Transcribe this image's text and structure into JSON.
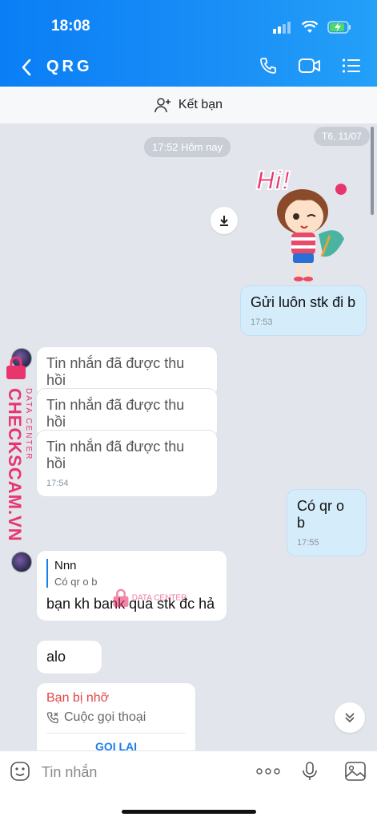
{
  "status_bar": {
    "time": "18:08"
  },
  "header": {
    "title": "QRG"
  },
  "friend_bar": {
    "label": "Kết bạn"
  },
  "chat": {
    "date_pill": "T6, 11/07",
    "time_pill": "17:52 Hôm nay",
    "messages": [
      {
        "text": "Gửi luôn stk đi b",
        "time": "17:53"
      },
      {
        "text": "Tin nhắn đã được thu hồi"
      },
      {
        "text": "Tin nhắn đã được thu hồi"
      },
      {
        "text": "Tin nhắn đã được thu hồi",
        "time": "17:54"
      },
      {
        "text": "Có qr o b",
        "time": "17:55"
      },
      {
        "reply_name": "Nnn",
        "reply_text": "Có qr o b",
        "text": "bạn kh bank qua stk đc hả"
      },
      {
        "text": "alo"
      },
      {
        "call_title": "Bạn bị nhỡ",
        "call_sub": "Cuộc gọi thoại",
        "call_button": "GỌI LẠI"
      }
    ]
  },
  "sticker": {
    "text": "Hi!"
  },
  "watermark": {
    "brand": "CHECKSCAM.VN",
    "sub": "DATA CENTER"
  },
  "input": {
    "placeholder": "Tin nhắn"
  },
  "colors": {
    "header": "#0a7ef5",
    "outgoing": "#d5ecfb",
    "missed_call": "#e04646",
    "watermark": "#e8356d"
  }
}
